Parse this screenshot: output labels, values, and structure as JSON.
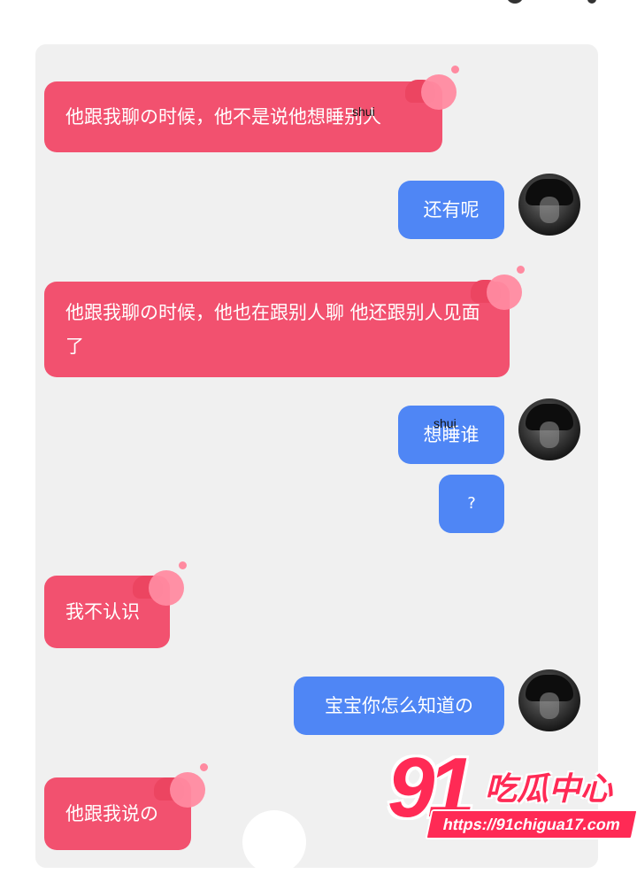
{
  "messages": [
    {
      "side": "in",
      "text": "他跟我聊の时候，他不是说他想睡别人",
      "hearts": true
    },
    {
      "side": "out",
      "text": "还有呢"
    },
    {
      "side": "in",
      "text": "他跟我聊の时候，他也在跟别人聊 他还跟别人见面了",
      "hearts": true
    },
    {
      "side": "out",
      "text": "想睡谁"
    },
    {
      "side": "out",
      "text": "?"
    },
    {
      "side": "in",
      "text": "我不认识",
      "hearts": true
    },
    {
      "side": "out",
      "text": "宝宝你怎么知道の"
    },
    {
      "side": "in",
      "text": "他跟我说の",
      "hearts": true
    }
  ],
  "annotations": [
    "shui",
    "shui"
  ],
  "watermark": {
    "number": "91",
    "name": "吃瓜中心",
    "url": "https://91chigua17.com"
  },
  "colors": {
    "incoming": "#f2516f",
    "outgoing": "#4f86f5",
    "panel": "#f0f0f0",
    "watermark": "#ff2a55"
  }
}
